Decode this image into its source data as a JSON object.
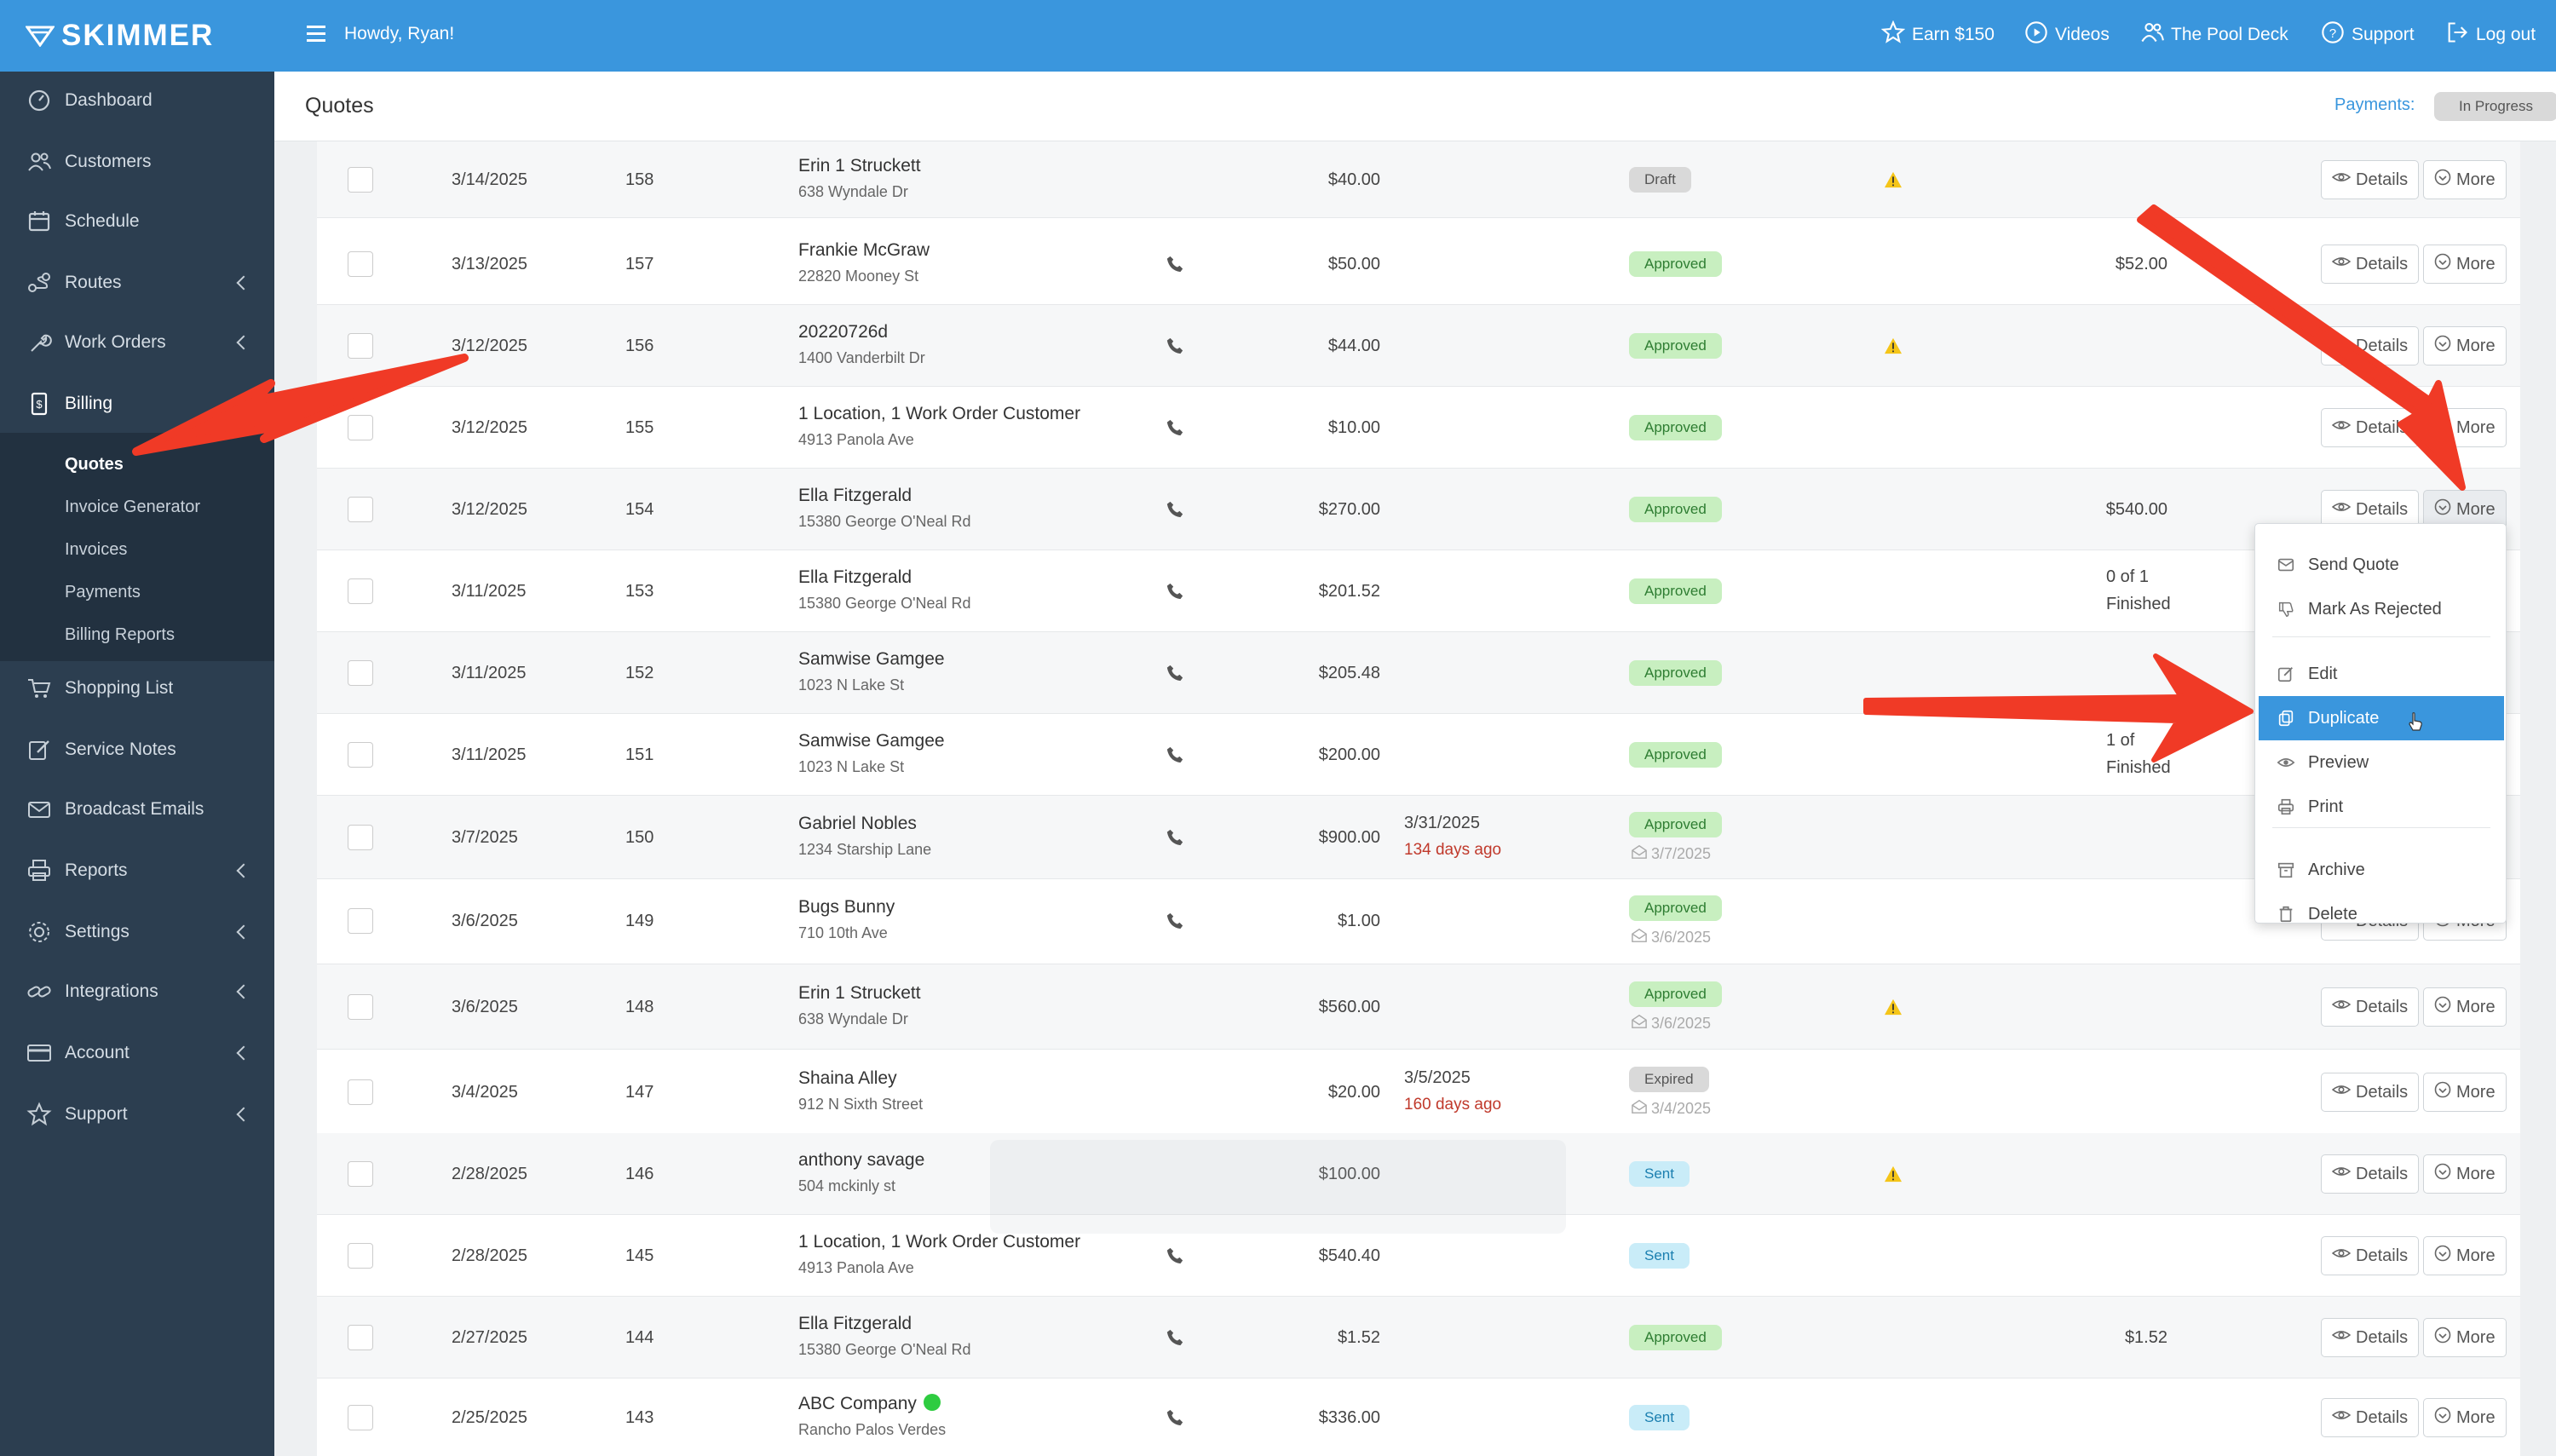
{
  "brand": {
    "logo_text": "SKIMMER",
    "accent": "#3a96dd",
    "sidebar_bg": "#2c3e50"
  },
  "topbar": {
    "greeting": "Howdy, Ryan!",
    "links": [
      {
        "label": "Earn $150",
        "icon": "star-icon"
      },
      {
        "label": "Videos",
        "icon": "play-circle-icon"
      },
      {
        "label": "The Pool Deck",
        "icon": "people-icon"
      },
      {
        "label": "Support",
        "icon": "help-circle-icon"
      },
      {
        "label": "Log out",
        "icon": "logout-icon"
      }
    ]
  },
  "sidebar": {
    "items": [
      {
        "label": "Dashboard",
        "icon": "gauge-icon",
        "chevron": false
      },
      {
        "label": "Customers",
        "icon": "users-icon",
        "chevron": false
      },
      {
        "label": "Schedule",
        "icon": "calendar-icon",
        "chevron": false
      },
      {
        "label": "Routes",
        "icon": "route-icon",
        "chevron": true
      },
      {
        "label": "Work Orders",
        "icon": "wrench-icon",
        "chevron": true
      },
      {
        "label": "Billing",
        "icon": "billing-icon",
        "chevron": true
      },
      {
        "label": "Shopping List",
        "icon": "cart-icon",
        "chevron": false
      },
      {
        "label": "Service Notes",
        "icon": "note-icon",
        "chevron": false
      },
      {
        "label": "Broadcast Emails",
        "icon": "mail-icon",
        "chevron": false
      },
      {
        "label": "Reports",
        "icon": "printer-icon",
        "chevron": true
      },
      {
        "label": "Settings",
        "icon": "gear-icon",
        "chevron": true
      },
      {
        "label": "Integrations",
        "icon": "link-icon",
        "chevron": true
      },
      {
        "label": "Account",
        "icon": "card-icon",
        "chevron": true
      },
      {
        "label": "Support",
        "icon": "star-outline-icon",
        "chevron": true
      }
    ],
    "billing_sub": [
      "Quotes",
      "Invoice Generator",
      "Invoices",
      "Payments",
      "Billing Reports"
    ]
  },
  "page": {
    "title": "Quotes",
    "payments_label": "Payments:",
    "payments_status": "In Progress"
  },
  "row_buttons": {
    "details": "Details",
    "more": "More"
  },
  "rows": [
    {
      "date": "3/14/2025",
      "num": "158",
      "name": "Erin 1 Struckett",
      "addr": "638 Wyndale Dr",
      "phone": false,
      "amount": "$40.00",
      "status": "Draft",
      "warn": true
    },
    {
      "date": "3/13/2025",
      "num": "157",
      "name": "Frankie McGraw",
      "addr": "22820 Mooney St",
      "phone": true,
      "amount": "$50.00",
      "status": "Approved",
      "invoiced": "$52.00"
    },
    {
      "date": "3/12/2025",
      "num": "156",
      "name": "20220726d",
      "addr": "1400 Vanderbilt Dr",
      "phone": true,
      "amount": "$44.00",
      "status": "Approved",
      "warn": true
    },
    {
      "date": "3/12/2025",
      "num": "155",
      "name": "1 Location, 1 Work Order Customer",
      "addr": "4913 Panola Ave",
      "phone": true,
      "amount": "$10.00",
      "status": "Approved"
    },
    {
      "date": "3/12/2025",
      "num": "154",
      "name": "Ella Fitzgerald",
      "addr": "15380 George O'Neal Rd",
      "phone": true,
      "amount": "$270.00",
      "status": "Approved",
      "invoiced": "$540.00",
      "active_more": true
    },
    {
      "date": "3/11/2025",
      "num": "153",
      "name": "Ella Fitzgerald",
      "addr": "15380 George O'Neal Rd",
      "phone": true,
      "amount": "$201.52",
      "status": "Approved",
      "wo1": "0 of 1",
      "wo2": "Finished"
    },
    {
      "date": "3/11/2025",
      "num": "152",
      "name": "Samwise Gamgee",
      "addr": "1023 N Lake St",
      "phone": true,
      "amount": "$205.48",
      "status": "Approved"
    },
    {
      "date": "3/11/2025",
      "num": "151",
      "name": "Samwise Gamgee",
      "addr": "1023 N Lake St",
      "phone": true,
      "amount": "$200.00",
      "status": "Approved",
      "wo1": "1 of",
      "wo2": "Finished"
    },
    {
      "date": "3/7/2025",
      "num": "150",
      "name": "Gabriel Nobles",
      "addr": "1234 Starship Lane",
      "phone": true,
      "amount": "$900.00",
      "due": "3/31/2025",
      "due_ago": "134 days ago",
      "status": "Approved",
      "sent_date": "3/7/2025"
    },
    {
      "date": "3/6/2025",
      "num": "149",
      "name": "Bugs Bunny",
      "addr": "710 10th Ave",
      "phone": true,
      "amount": "$1.00",
      "status": "Approved",
      "sent_date": "3/6/2025"
    },
    {
      "date": "3/6/2025",
      "num": "148",
      "name": "Erin 1 Struckett",
      "addr": "638 Wyndale Dr",
      "phone": false,
      "amount": "$560.00",
      "status": "Approved",
      "sent_date": "3/6/2025",
      "warn": true
    },
    {
      "date": "3/4/2025",
      "num": "147",
      "name": "Shaina Alley",
      "addr": "912 N Sixth Street",
      "phone": false,
      "amount": "$20.00",
      "due": "3/5/2025",
      "due_ago": "160 days ago",
      "status": "Expired",
      "sent_date": "3/4/2025"
    },
    {
      "date": "2/28/2025",
      "num": "146",
      "name": "anthony savage",
      "addr": "504 mckinly st",
      "phone": false,
      "amount": "$100.00",
      "status": "Sent",
      "warn": true
    },
    {
      "date": "2/28/2025",
      "num": "145",
      "name": "1 Location, 1 Work Order Customer",
      "addr": "4913 Panola Ave",
      "phone": true,
      "amount": "$540.40",
      "status": "Sent"
    },
    {
      "date": "2/27/2025",
      "num": "144",
      "name": "Ella Fitzgerald",
      "addr": "15380 George O'Neal Rd",
      "phone": true,
      "amount": "$1.52",
      "status": "Approved",
      "invoiced": "$1.52"
    },
    {
      "date": "2/25/2025",
      "num": "143",
      "name": "ABC Company",
      "addr": "Rancho Palos Verdes",
      "phone": true,
      "amount": "$336.00",
      "status": "Sent",
      "green_dot": true
    }
  ],
  "dropdown": {
    "items": [
      {
        "label": "Send Quote",
        "icon": "send-icon"
      },
      {
        "label": "Mark As Rejected",
        "icon": "thumbs-down-icon"
      },
      {
        "label": "Edit",
        "icon": "edit-icon"
      },
      {
        "label": "Duplicate",
        "icon": "copy-icon",
        "highlight": true
      },
      {
        "label": "Preview",
        "icon": "eye-icon"
      },
      {
        "label": "Print",
        "icon": "print-icon"
      },
      {
        "label": "Archive",
        "icon": "archive-icon"
      },
      {
        "label": "Delete",
        "icon": "trash-icon"
      }
    ]
  },
  "annotation_color": "#f03a26"
}
